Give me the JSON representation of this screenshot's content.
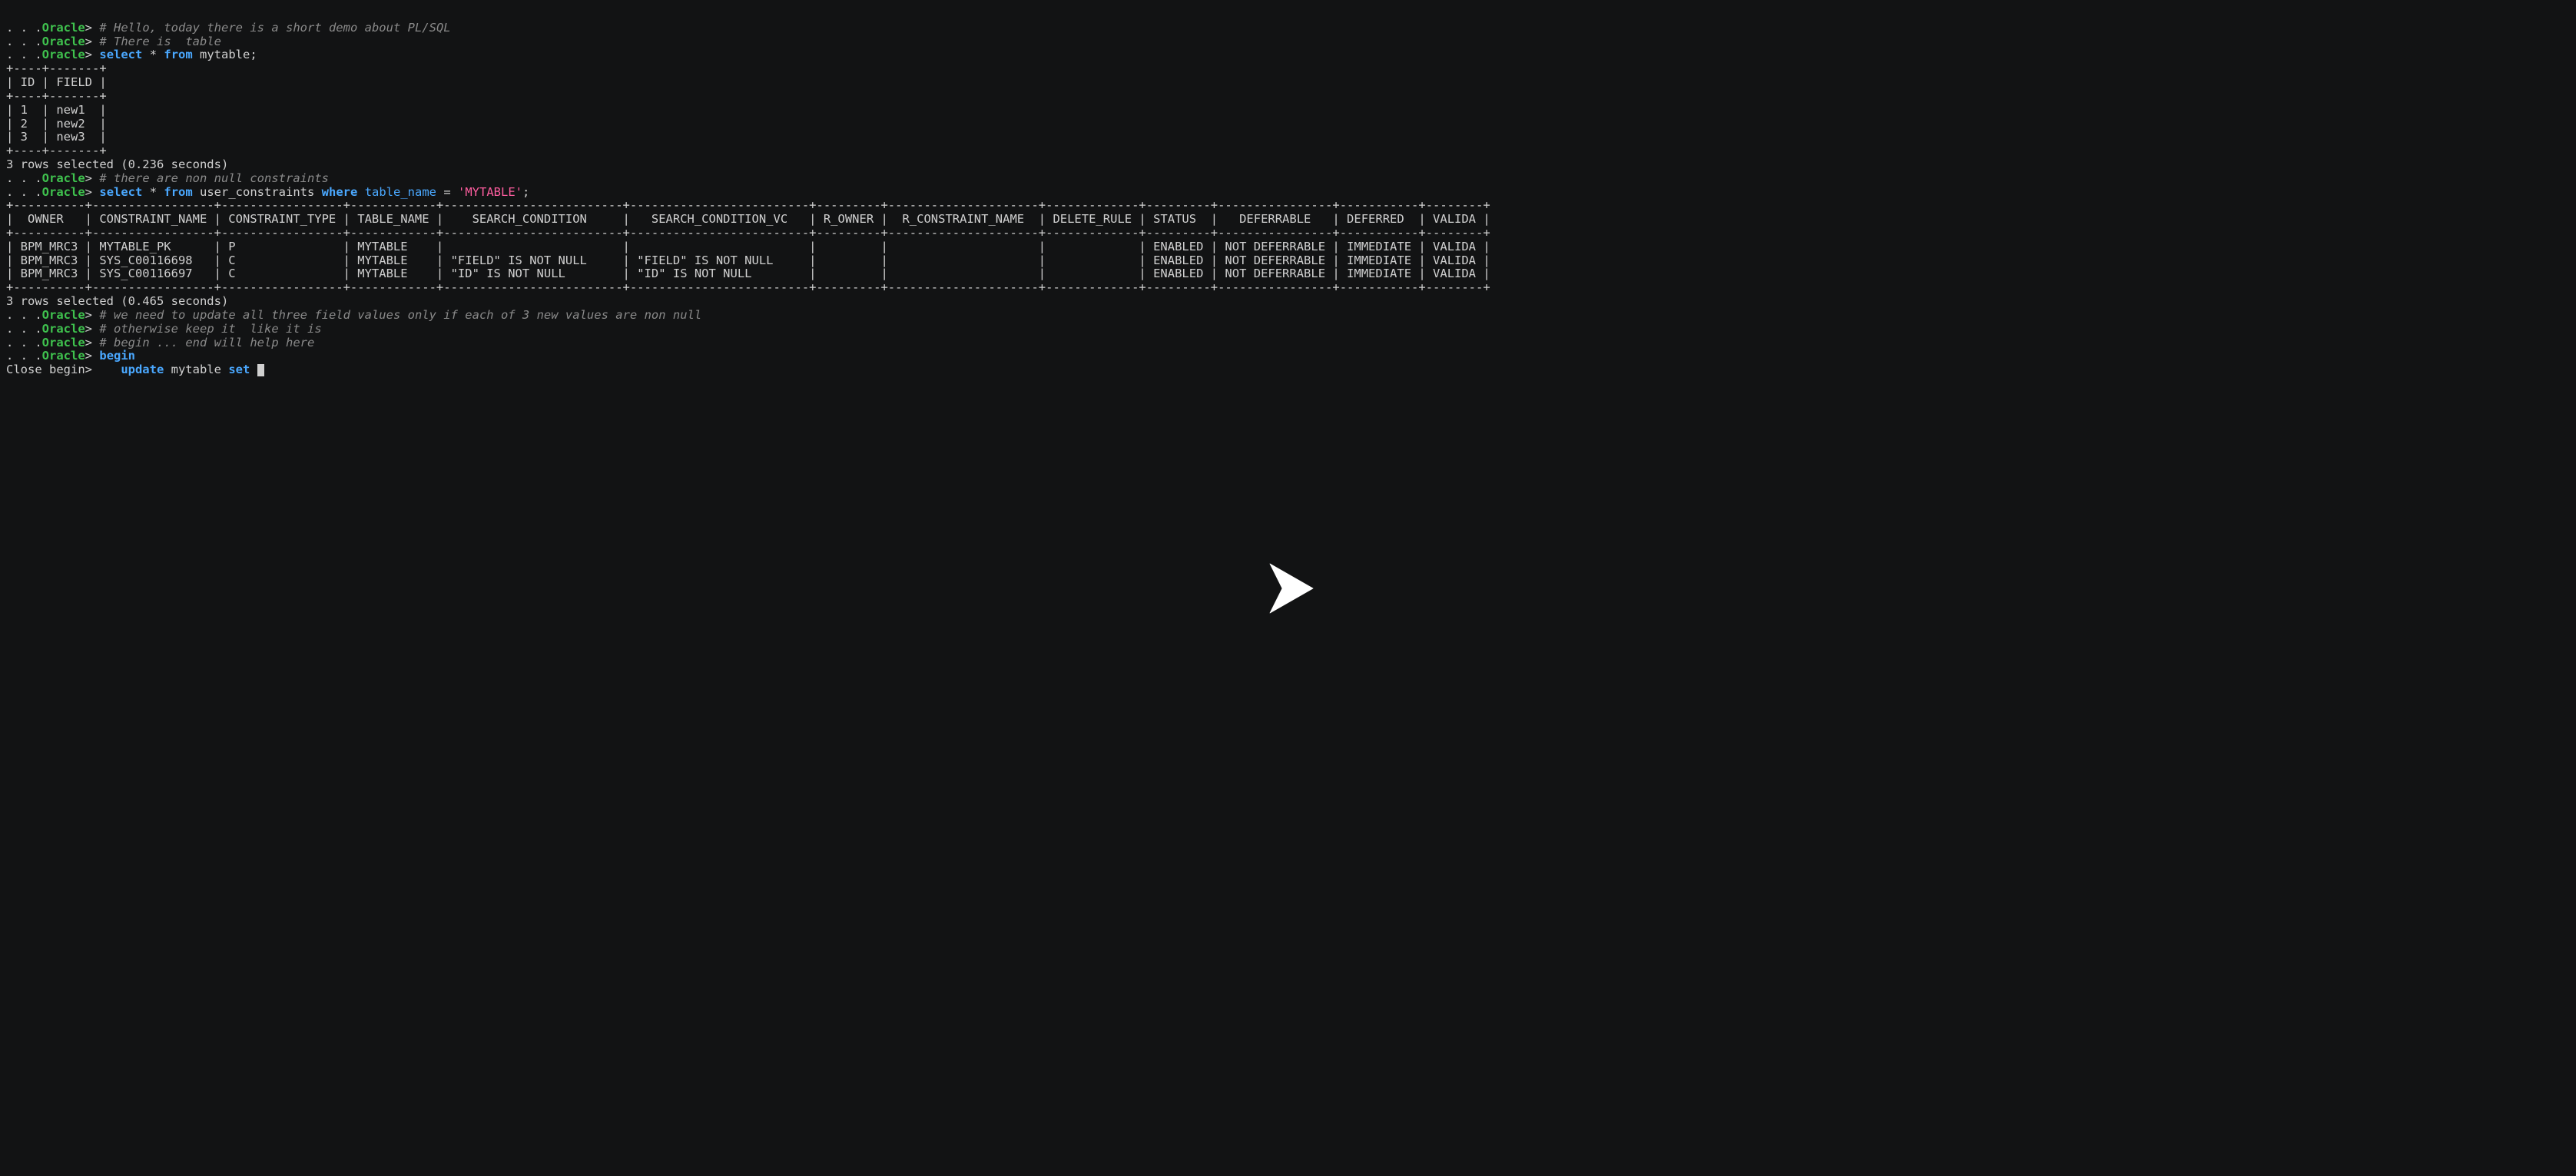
{
  "prompt": {
    "dots": ". . .",
    "host": "Oracle",
    "gt": ">",
    "close_begin": "Close begin>"
  },
  "lines": {
    "c1": "# Hello, today there is a short demo about PL/SQL",
    "c2": "# There is  table",
    "sel1_select": "select",
    "sel1_star": " * ",
    "sel1_from": "from",
    "sel1_tail": " mytable;",
    "tbl1_sep": "+----+-------+",
    "tbl1_hdr": "| ID | FIELD |",
    "tbl1_r1": "| 1  | new1  |",
    "tbl1_r2": "| 2  | new2  |",
    "tbl1_r3": "| 3  | new3  |",
    "rows1": "3 rows selected (0.236 seconds)",
    "c3": "# there are non null constraints",
    "sel2_select": "select",
    "sel2_star": " * ",
    "sel2_from": "from",
    "sel2_mid": " user_constraints ",
    "sel2_where": "where",
    "sel2_sp": " ",
    "sel2_col": "table_name",
    "sel2_eq": " = ",
    "sel2_str": "'MYTABLE'",
    "sel2_semi": ";",
    "tbl2_sep": "+----------+-----------------+-----------------+------------+-------------------------+-------------------------+---------+---------------------+-------------+---------+----------------+-----------+--------+",
    "tbl2_hdr": "|  OWNER   | CONSTRAINT_NAME | CONSTRAINT_TYPE | TABLE_NAME |    SEARCH_CONDITION     |   SEARCH_CONDITION_VC   | R_OWNER |  R_CONSTRAINT_NAME  | DELETE_RULE | STATUS  |   DEFERRABLE   | DEFERRED  | VALIDA |",
    "tbl2_r1": "| BPM_MRC3 | MYTABLE_PK      | P               | MYTABLE    |                         |                         |         |                     |             | ENABLED | NOT DEFERRABLE | IMMEDIATE | VALIDA |",
    "tbl2_r2": "| BPM_MRC3 | SYS_C00116698   | C               | MYTABLE    | \"FIELD\" IS NOT NULL     | \"FIELD\" IS NOT NULL     |         |                     |             | ENABLED | NOT DEFERRABLE | IMMEDIATE | VALIDA |",
    "tbl2_r3": "| BPM_MRC3 | SYS_C00116697   | C               | MYTABLE    | \"ID\" IS NOT NULL        | \"ID\" IS NOT NULL        |         |                     |             | ENABLED | NOT DEFERRABLE | IMMEDIATE | VALIDA |",
    "rows2": "3 rows selected (0.465 seconds)",
    "c4": "# we need to update all three field values only if each of 3 new values are non null",
    "c5": "# otherwise keep it  like it is",
    "c6": "# begin ... end will help here",
    "begin": "begin",
    "upd_indent": "    ",
    "upd_update": "update",
    "upd_mid": " mytable ",
    "upd_set": "set",
    "upd_tail": " "
  },
  "chart_data": {
    "type": "table",
    "tables": [
      {
        "name": "mytable",
        "columns": [
          "ID",
          "FIELD"
        ],
        "rows": [
          [
            1,
            "new1"
          ],
          [
            2,
            "new2"
          ],
          [
            3,
            "new3"
          ]
        ],
        "rows_selected": 3,
        "elapsed_seconds": 0.236
      },
      {
        "name": "user_constraints",
        "filter": {
          "TABLE_NAME": "MYTABLE"
        },
        "columns": [
          "OWNER",
          "CONSTRAINT_NAME",
          "CONSTRAINT_TYPE",
          "TABLE_NAME",
          "SEARCH_CONDITION",
          "SEARCH_CONDITION_VC",
          "R_OWNER",
          "R_CONSTRAINT_NAME",
          "DELETE_RULE",
          "STATUS",
          "DEFERRABLE",
          "DEFERRED",
          "VALIDA"
        ],
        "rows": [
          [
            "BPM_MRC3",
            "MYTABLE_PK",
            "P",
            "MYTABLE",
            "",
            "",
            "",
            "",
            "",
            "ENABLED",
            "NOT DEFERRABLE",
            "IMMEDIATE",
            "VALIDA"
          ],
          [
            "BPM_MRC3",
            "SYS_C00116698",
            "C",
            "MYTABLE",
            "\"FIELD\" IS NOT NULL",
            "\"FIELD\" IS NOT NULL",
            "",
            "",
            "",
            "ENABLED",
            "NOT DEFERRABLE",
            "IMMEDIATE",
            "VALIDA"
          ],
          [
            "BPM_MRC3",
            "SYS_C00116697",
            "C",
            "MYTABLE",
            "\"ID\" IS NOT NULL",
            "\"ID\" IS NOT NULL",
            "",
            "",
            "",
            "ENABLED",
            "NOT DEFERRABLE",
            "IMMEDIATE",
            "VALIDA"
          ]
        ],
        "rows_selected": 3,
        "elapsed_seconds": 0.465
      }
    ]
  }
}
